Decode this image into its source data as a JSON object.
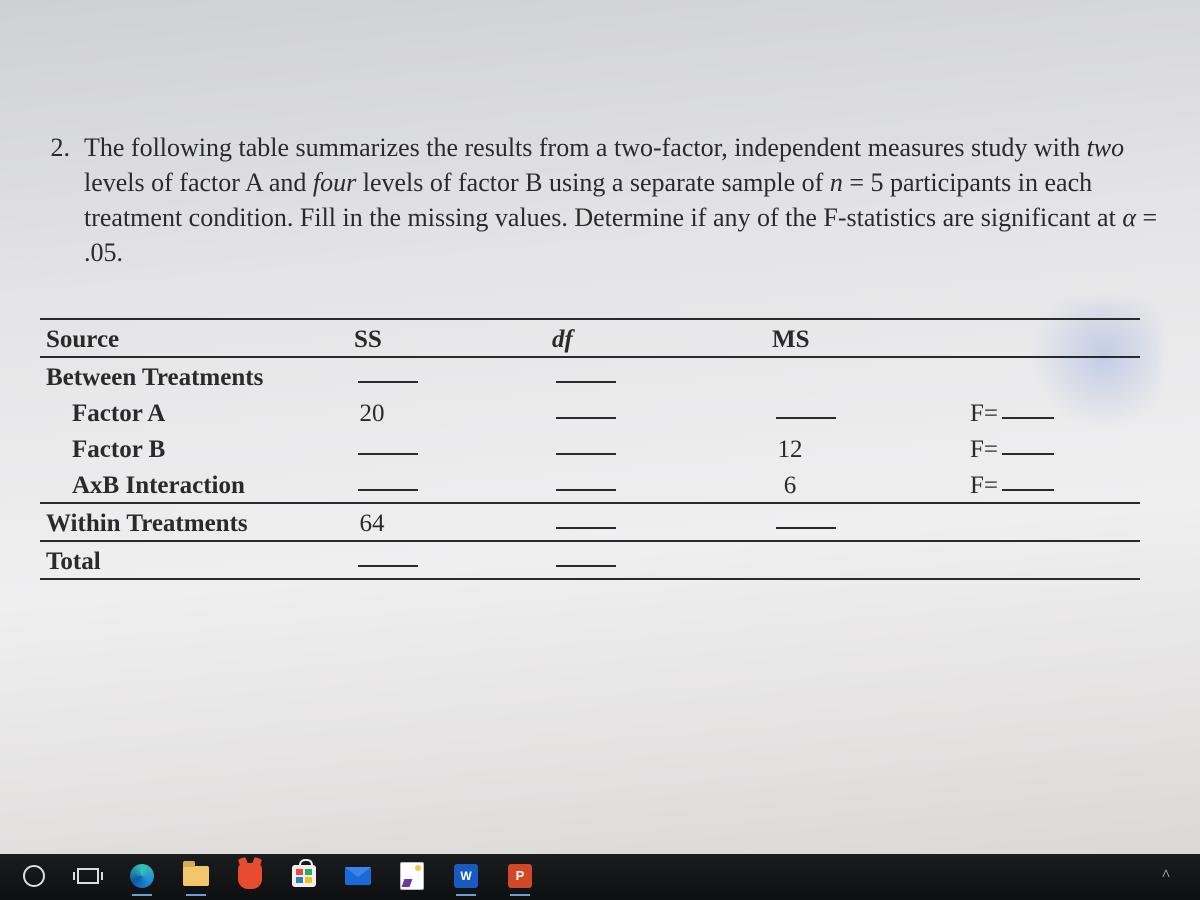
{
  "question": {
    "number": "2.",
    "text_parts": {
      "p1": "The following table summarizes the results from a two-factor, independent measures study with ",
      "two": "two",
      "p2": " levels of factor A and ",
      "four": "four",
      "p3": " levels of factor B using a separate sample of ",
      "n": "n",
      "p4": " = 5 participants in each treatment condition. Fill in the missing values. Determine if any of the F-statistics are significant at ",
      "alpha": "α",
      "p5": " = .05."
    }
  },
  "table": {
    "headers": {
      "source": "Source",
      "ss": "SS",
      "df": "df",
      "ms": "MS"
    },
    "rows": {
      "between": {
        "label": "Between Treatments"
      },
      "factorA": {
        "label": "Factor A",
        "ss": "20",
        "f_prefix": "F="
      },
      "factorB": {
        "label": "Factor B",
        "ms": "12",
        "f_prefix": "F="
      },
      "axb": {
        "label": "AxB Interaction",
        "ms": "6",
        "f_prefix": "F="
      },
      "within": {
        "label": "Within Treatments",
        "ss": "64"
      },
      "total": {
        "label": "Total"
      }
    }
  },
  "taskbar": {
    "start": "Start",
    "taskview": "Task View",
    "edge": "Microsoft Edge",
    "explorer": "File Explorer",
    "brave": "Brave",
    "store": "Microsoft Store",
    "mail": "Mail",
    "paint": "Paint",
    "word": "W",
    "ppt": "P",
    "chevron": "^"
  }
}
